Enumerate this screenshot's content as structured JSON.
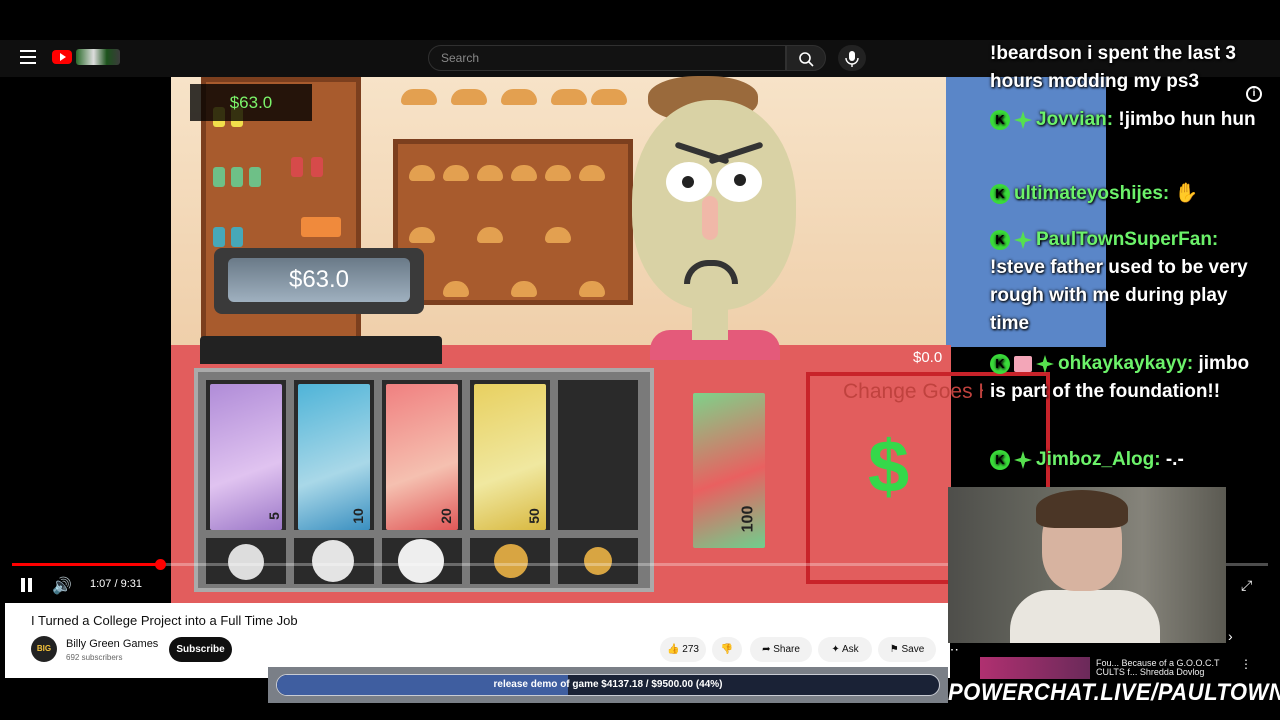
{
  "browser": {
    "search_placeholder": "Search"
  },
  "video": {
    "overlay_total": "$63.0",
    "register_display": "$63.0",
    "change_amount": "$0.0",
    "change_label": "Change Goes H",
    "dollar_sign": "$",
    "drawer_notes": [
      "5",
      "10",
      "20",
      "50"
    ],
    "counter_note": "100",
    "time_current": "1:07",
    "time_total": "9:31",
    "time_separator": " / ",
    "progress_fraction": 0.118
  },
  "video_info": {
    "title": "I Turned a College Project into a Full Time Job",
    "channel": "Billy Green Games",
    "subscribers": "692 subscribers",
    "channel_avatar_text": "BIG",
    "subscribe_label": "Subscribe",
    "likes": "273",
    "share_label": "Share",
    "ask_label": "Ask",
    "save_label": "Save"
  },
  "chat": [
    {
      "user": "",
      "text": "!beardson i spent the last 3 hours modding my ps3"
    },
    {
      "user": "Jovvian:",
      "text": "!jimbo hun hun"
    },
    {
      "user": "ultimateyoshijes:",
      "text": ""
    },
    {
      "user": "PaulTownSuperFan:",
      "text": "!steve father used to be very rough with me during play time"
    },
    {
      "user": "ohkaykaykayy:",
      "text": "jimbo is part of the foundation!!"
    },
    {
      "user": "Jimboz_Alog:",
      "text": "-.-"
    }
  ],
  "recommendation_snippet": "Fou... Because of a G.O.O.C.T CULTS f... Shredda Dovlog",
  "donation_goal": {
    "label": "release demo of game $4137.18 / $9500.00 (44%)",
    "fraction": 0.44
  },
  "brand": "POWERCHAT.LIVE/PAULTOWN",
  "colors": {
    "youtube_red": "#ff0000",
    "chat_user_green": "#6cf26a",
    "dollar_green": "#35d84a"
  }
}
